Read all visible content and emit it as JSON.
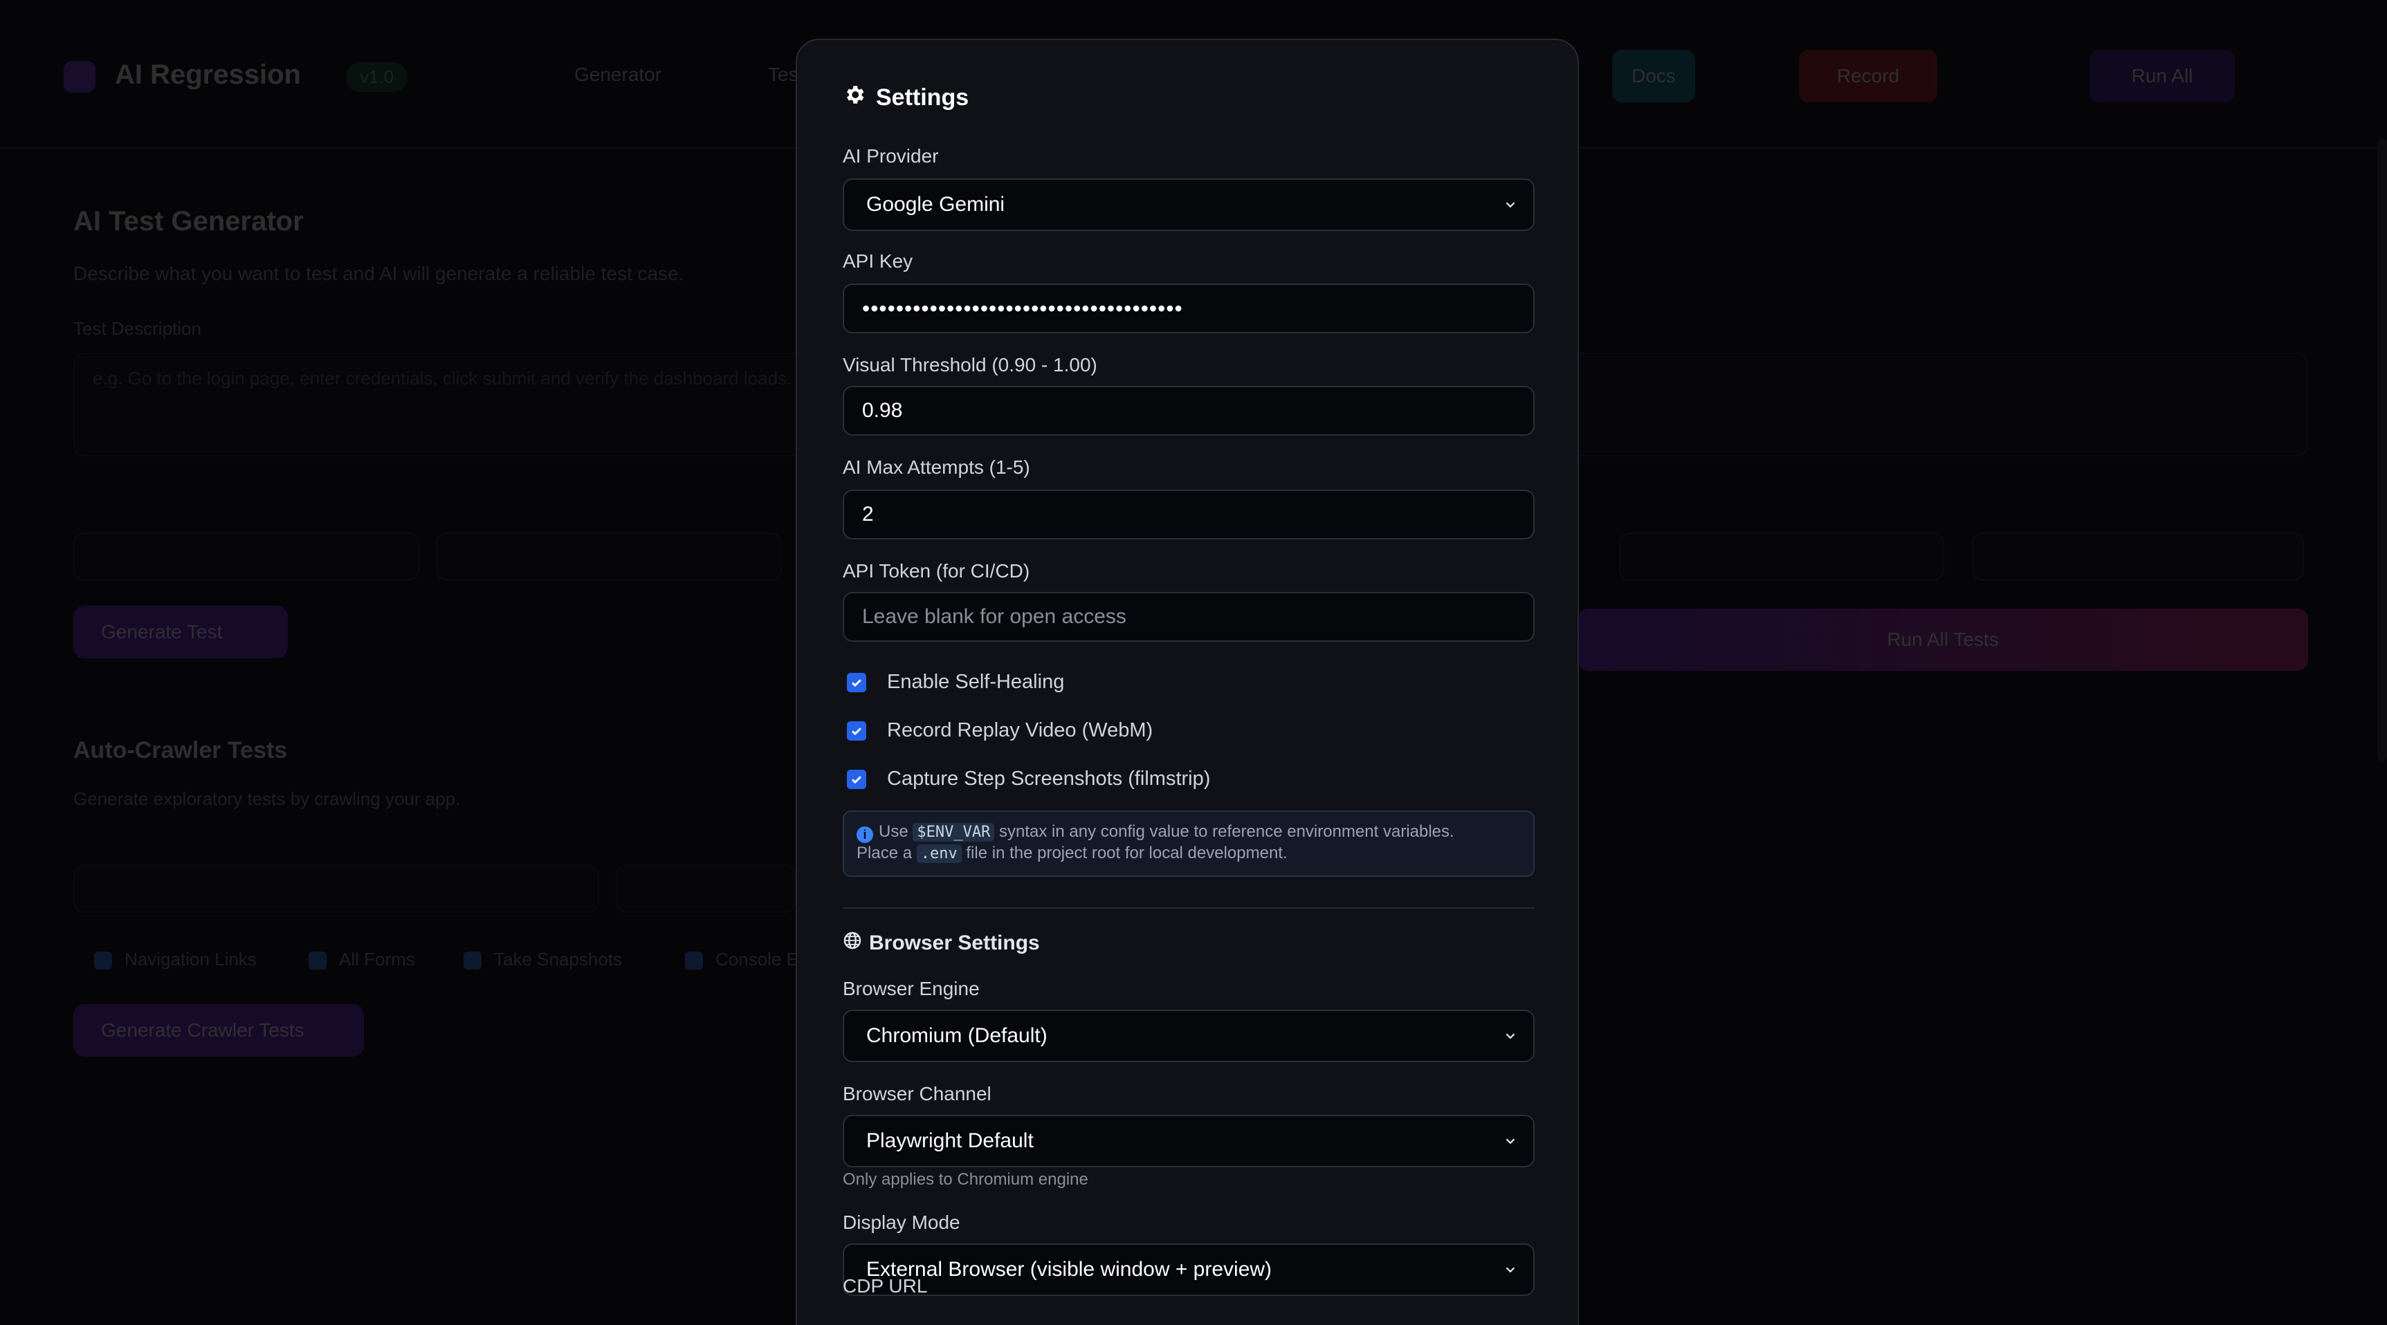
{
  "background": {
    "app_title": "AI Regression",
    "badge": "v1.0",
    "nav": [
      "Generator",
      "Tests"
    ],
    "top_buttons": [
      "Docs",
      "Record",
      "Run All"
    ],
    "section1_title": "AI Test Generator",
    "section1_desc": "Describe what you want to test and AI will generate a reliable test case.",
    "section1_label": "Test Description",
    "section1_placeholder": "e.g. Go to the login page, enter credentials, click submit and verify the dashboard loads.",
    "generate_button": "Generate Test",
    "run_button": "Run All Tests",
    "section2_title": "Auto-Crawler Tests",
    "section2_desc": "Generate exploratory tests by crawling your app.",
    "crawl_chips": [
      "Navigation Links",
      "All Forms",
      "Take Snapshots",
      "Console Errors"
    ],
    "crawl_button": "Generate Crawler Tests"
  },
  "modal": {
    "title": "Settings",
    "ai_provider": {
      "label": "AI Provider",
      "value": "Google Gemini"
    },
    "api_key": {
      "label": "API Key",
      "value": "••••••••••••••••••••••••••••••••••••••"
    },
    "visual_threshold": {
      "label": "Visual Threshold (0.90 - 1.00)",
      "value": "0.98"
    },
    "ai_max_attempts": {
      "label": "AI Max Attempts (1-5)",
      "value": "2"
    },
    "api_token": {
      "label": "API Token (for CI/CD)",
      "placeholder": "Leave blank for open access"
    },
    "checks": [
      {
        "label": "Enable Self-Healing",
        "checked": true
      },
      {
        "label": "Record Replay Video (WebM)",
        "checked": true
      },
      {
        "label": "Capture Step Screenshots (filmstrip)",
        "checked": true
      }
    ],
    "info": {
      "use": "Use",
      "env_var": "$ENV_VAR",
      "line1_rest": "syntax in any config value to reference environment variables.",
      "place_a": "Place a",
      "env_file": ".env",
      "line2_rest": "file in the project root for local development."
    },
    "browser_settings_title": "Browser Settings",
    "browser_engine": {
      "label": "Browser Engine",
      "value": "Chromium (Default)"
    },
    "browser_channel": {
      "label": "Browser Channel",
      "value": "Playwright Default",
      "hint": "Only applies to Chromium engine"
    },
    "display_mode": {
      "label": "Display Mode",
      "value": "External Browser (visible window + preview)"
    },
    "cdp_url_label": "CDP URL"
  },
  "colors": {
    "accent": "#2563eb",
    "modal_bg": "#101116",
    "page_bg": "#050507"
  }
}
